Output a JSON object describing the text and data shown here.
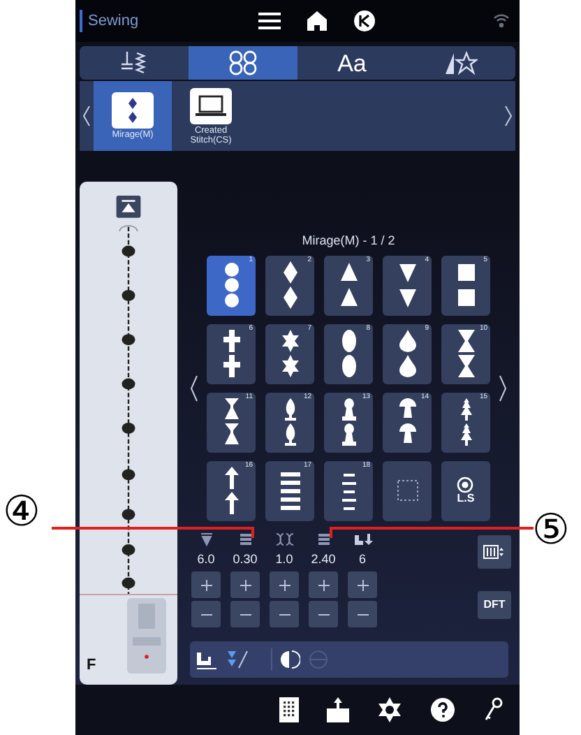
{
  "status_bar": {
    "title": "Sewing"
  },
  "tabs": [
    {
      "kind": "utility",
      "selected": false
    },
    {
      "kind": "decorative",
      "selected": true
    },
    {
      "kind": "text",
      "label": "Aa",
      "selected": false
    },
    {
      "kind": "favorites",
      "selected": false
    }
  ],
  "categories": [
    {
      "kind": "mirage",
      "label": "Mirage(M)",
      "selected": true
    },
    {
      "kind": "created",
      "label": "Created Stitch(CS)",
      "selected": false
    }
  ],
  "page_title": "Mirage(M) - 1 / 2",
  "stitches": [
    {
      "number": "1",
      "kind": "circles",
      "selected": true
    },
    {
      "number": "2",
      "kind": "diamond",
      "selected": false
    },
    {
      "number": "3",
      "kind": "triangle-up",
      "selected": false
    },
    {
      "number": "4",
      "kind": "triangle-down",
      "selected": false
    },
    {
      "number": "5",
      "kind": "square",
      "selected": false
    },
    {
      "number": "6",
      "kind": "cross",
      "selected": false
    },
    {
      "number": "7",
      "kind": "star",
      "selected": false
    },
    {
      "number": "8",
      "kind": "oval",
      "selected": false
    },
    {
      "number": "9",
      "kind": "drop",
      "selected": false
    },
    {
      "number": "10",
      "kind": "hourglass",
      "selected": false
    },
    {
      "number": "11",
      "kind": "goblet",
      "selected": false
    },
    {
      "number": "12",
      "kind": "vase",
      "selected": false
    },
    {
      "number": "13",
      "kind": "pawn",
      "selected": false
    },
    {
      "number": "14",
      "kind": "mushroom",
      "selected": false
    },
    {
      "number": "15",
      "kind": "tree",
      "selected": false
    },
    {
      "number": "16",
      "kind": "arrow",
      "selected": false
    },
    {
      "number": "17",
      "kind": "bars",
      "selected": false
    },
    {
      "number": "18",
      "kind": "dashes",
      "selected": false
    },
    {
      "kind": "empty",
      "selected": false
    },
    {
      "kind": "ls",
      "label": "L.S",
      "selected": false
    }
  ],
  "settings": [
    {
      "kind": "width",
      "value": "6.0"
    },
    {
      "kind": "density",
      "value": "0.30"
    },
    {
      "kind": "tension",
      "value": "1.0"
    },
    {
      "kind": "length",
      "value": "2.40"
    },
    {
      "kind": "pressure",
      "value": "6"
    }
  ],
  "side_buttons": [
    {
      "kind": "layout"
    },
    {
      "kind": "text",
      "label": "DFT"
    }
  ],
  "presser_foot": {
    "label": "F"
  },
  "callouts": [
    {
      "label": "④"
    },
    {
      "label": "⑤"
    }
  ]
}
